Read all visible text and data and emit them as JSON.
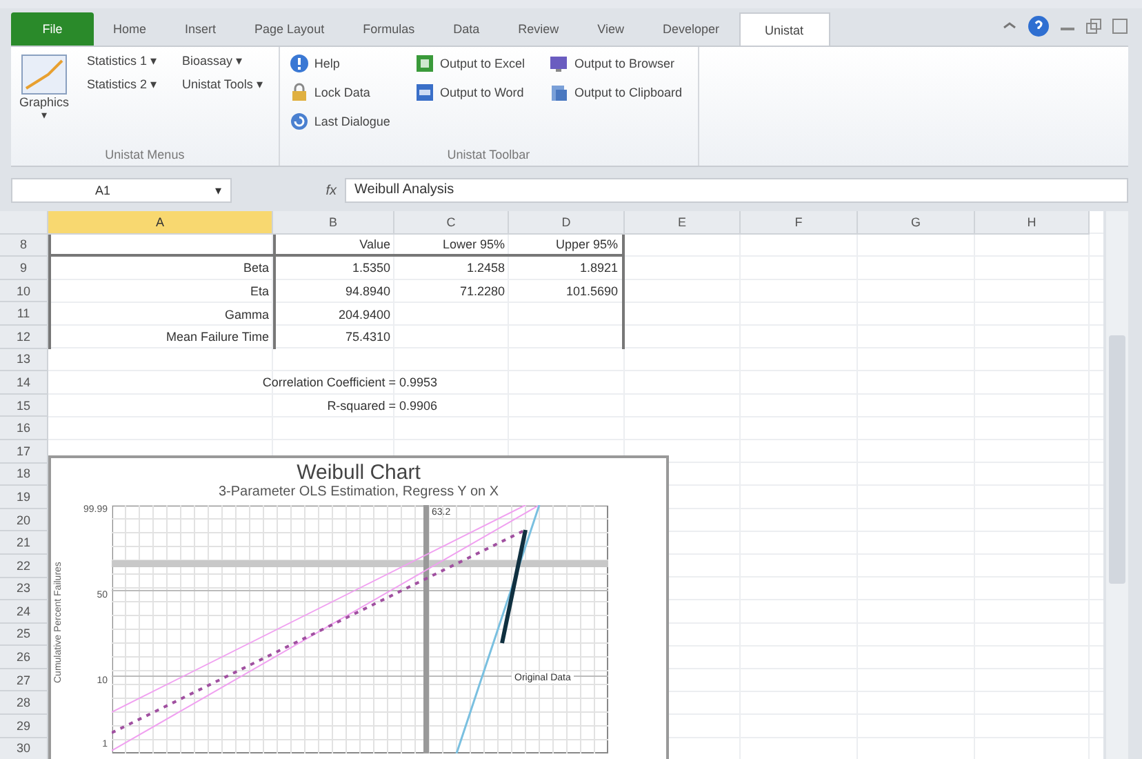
{
  "tabs": [
    {
      "label": "File",
      "kind": "file",
      "selected": false
    },
    {
      "label": "Home",
      "kind": "tab",
      "selected": false
    },
    {
      "label": "Insert",
      "kind": "tab",
      "selected": false
    },
    {
      "label": "Page Layout",
      "kind": "tab",
      "selected": false
    },
    {
      "label": "Formulas",
      "kind": "tab",
      "selected": false
    },
    {
      "label": "Data",
      "kind": "tab",
      "selected": false
    },
    {
      "label": "Review",
      "kind": "tab",
      "selected": false
    },
    {
      "label": "View",
      "kind": "tab",
      "selected": false
    },
    {
      "label": "Developer",
      "kind": "tab",
      "selected": false
    },
    {
      "label": "Unistat",
      "kind": "tab",
      "selected": true
    }
  ],
  "ribbon": {
    "menus": {
      "label": "Unistat Menus",
      "large": {
        "label": "Graphics",
        "caret": "▾"
      },
      "columns": [
        [
          {
            "label": "Statistics 1",
            "caret": "▾"
          },
          {
            "label": "Statistics 2",
            "caret": "▾"
          }
        ],
        [
          {
            "label": "Bioassay",
            "caret": "▾"
          },
          {
            "label": "Unistat Tools",
            "caret": "▾"
          }
        ]
      ]
    },
    "toolbar": {
      "label": "Unistat Toolbar",
      "columns": [
        [
          {
            "label": "Help"
          },
          {
            "label": "Lock Data"
          },
          {
            "label": "Last Dialogue"
          }
        ],
        [
          {
            "label": "Output to Excel"
          },
          {
            "label": "Output to Word"
          }
        ],
        [
          {
            "label": "Output to Browser"
          },
          {
            "label": "Output to Clipboard"
          }
        ]
      ]
    }
  },
  "formula_bar": {
    "name_box": "A1",
    "name_box_caret": "▾",
    "fx": "fx",
    "formula": "Weibull Analysis"
  },
  "columns": [
    {
      "label": "A",
      "selected": true
    },
    {
      "label": "B",
      "selected": false
    },
    {
      "label": "C",
      "selected": false
    },
    {
      "label": "D",
      "selected": false
    },
    {
      "label": "E",
      "selected": false
    },
    {
      "label": "F",
      "selected": false
    },
    {
      "label": "G",
      "selected": false
    },
    {
      "label": "H",
      "selected": false
    }
  ],
  "rows": [
    {
      "number": "8",
      "kind": "table_head",
      "cells": [
        "",
        "Value",
        "Lower 95%",
        "Upper 95%"
      ]
    },
    {
      "number": "9",
      "kind": "table_row",
      "cells": [
        "Beta",
        "1.5350",
        "1.2458",
        "1.8921"
      ]
    },
    {
      "number": "10",
      "kind": "table_row",
      "cells": [
        "Eta",
        "94.8940",
        "71.2280",
        "101.5690"
      ]
    },
    {
      "number": "11",
      "kind": "table_row",
      "cells": [
        "Gamma",
        "204.9400",
        "",
        ""
      ]
    },
    {
      "number": "12",
      "kind": "table_row",
      "cells": [
        "Mean Failure Time",
        "75.4310",
        "",
        ""
      ]
    },
    {
      "number": "13",
      "kind": "blank"
    },
    {
      "number": "14",
      "kind": "note",
      "text": "Correlation Coefficient = 0.9953"
    },
    {
      "number": "15",
      "kind": "note",
      "text": "R-squared = 0.9906"
    },
    {
      "number": "16",
      "kind": "blank"
    },
    {
      "number": "17",
      "kind": "blank"
    },
    {
      "number": "18",
      "kind": "blank"
    },
    {
      "number": "19",
      "kind": "blank"
    },
    {
      "number": "20",
      "kind": "blank"
    },
    {
      "number": "21",
      "kind": "blank"
    },
    {
      "number": "22",
      "kind": "blank"
    },
    {
      "number": "23",
      "kind": "blank"
    },
    {
      "number": "24",
      "kind": "blank"
    },
    {
      "number": "25",
      "kind": "blank"
    },
    {
      "number": "26",
      "kind": "blank"
    },
    {
      "number": "27",
      "kind": "blank"
    },
    {
      "number": "28",
      "kind": "blank"
    },
    {
      "number": "29",
      "kind": "blank"
    },
    {
      "number": "30",
      "kind": "blank"
    }
  ],
  "chart": {
    "title": "Weibull Chart",
    "subtitle": "3-Parameter OLS Estimation, Regress Y on X",
    "ylabel": "Cumulative Percent Failures",
    "yticks": [
      "99.99",
      "50",
      "10",
      "1"
    ],
    "marker_label": "63.2",
    "series_label": "Original Data"
  }
}
